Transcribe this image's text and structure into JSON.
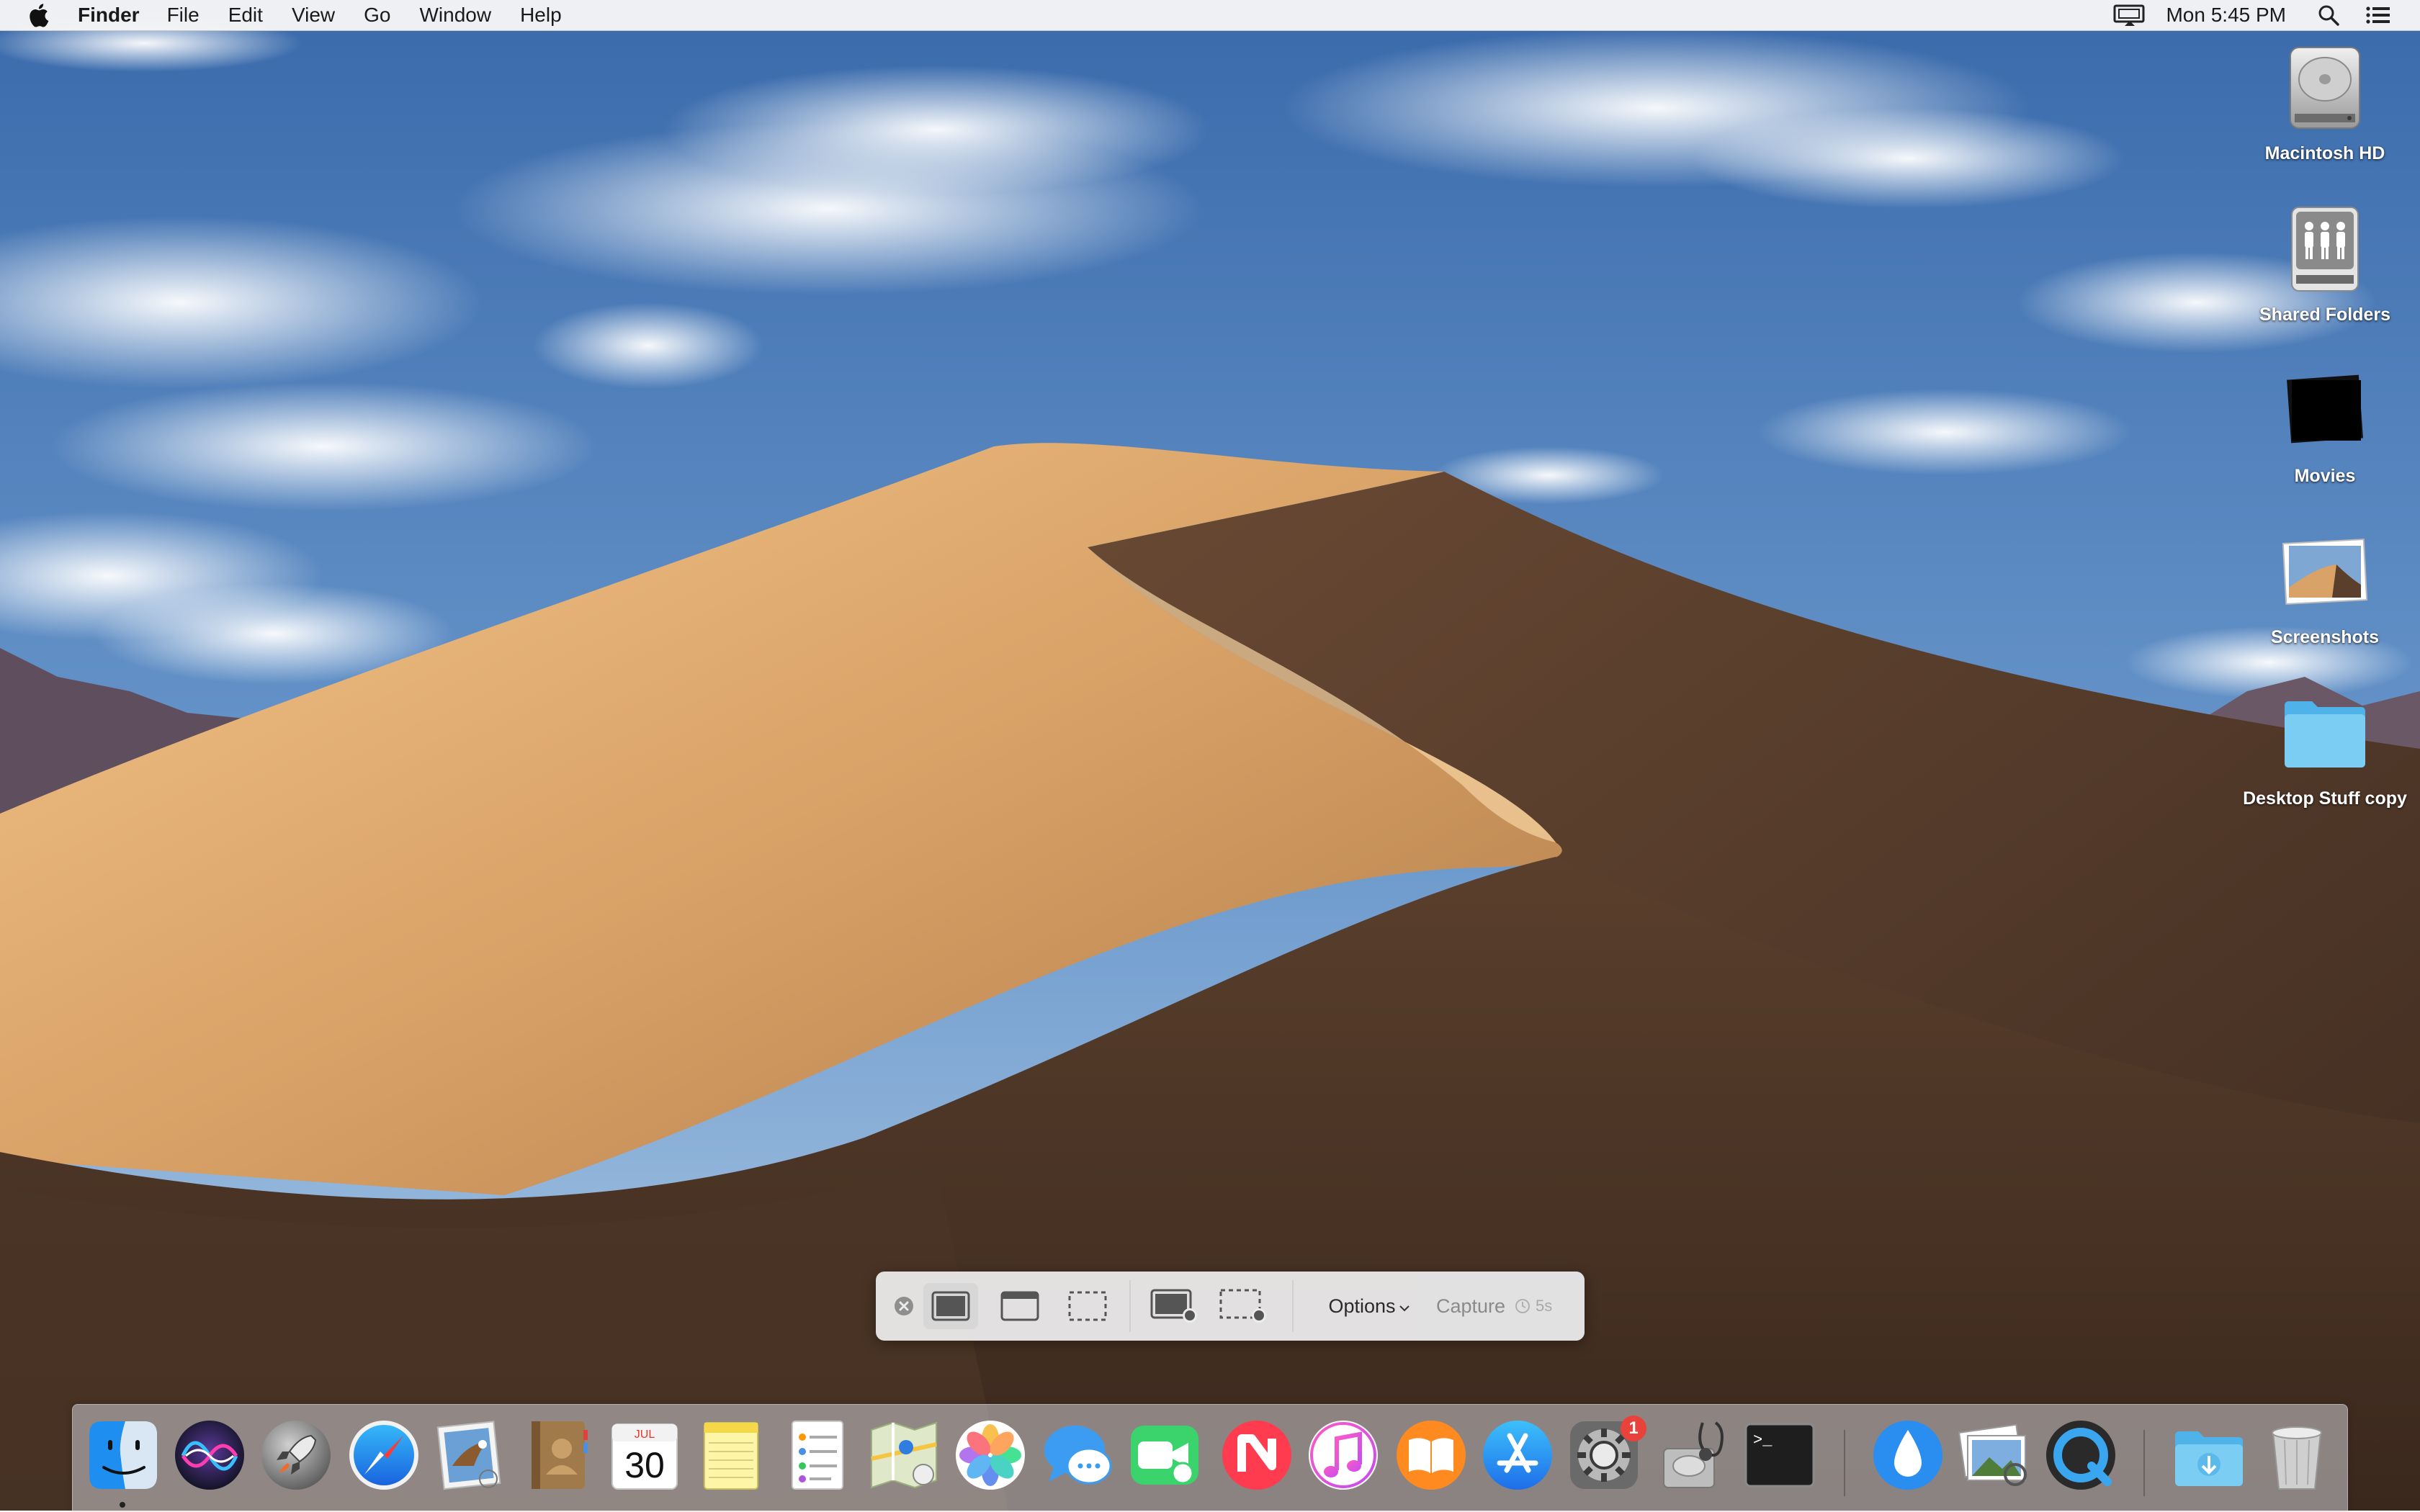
{
  "menubar": {
    "app_name": "Finder",
    "menus": [
      "File",
      "Edit",
      "View",
      "Go",
      "Window",
      "Help"
    ],
    "clock": "Mon 5:45 PM",
    "status_icons": [
      "airplay-display-icon",
      "spotlight-search-icon",
      "notification-center-icon"
    ]
  },
  "desktop": {
    "icons": [
      {
        "label": "Macintosh HD",
        "icon": "hard-drive-icon"
      },
      {
        "label": "Shared Folders",
        "icon": "shared-folders-drive-icon"
      },
      {
        "label": "Movies",
        "icon": "movies-folder-icon"
      },
      {
        "label": "Screenshots",
        "icon": "screenshots-image-icon"
      },
      {
        "label": "Desktop Stuff copy",
        "icon": "folder-icon"
      }
    ]
  },
  "screenshot_toolbar": {
    "tools": [
      "close-icon",
      "capture-entire-screen-icon",
      "capture-selected-window-icon",
      "capture-selected-portion-icon",
      "record-entire-screen-icon",
      "record-selected-portion-icon"
    ],
    "selected_tool": "capture-entire-screen-icon",
    "options_label": "Options",
    "capture_label": "Capture",
    "timer_label": "5s"
  },
  "dock": {
    "apps": [
      {
        "name": "Finder",
        "icon": "finder-icon",
        "running": true
      },
      {
        "name": "Siri",
        "icon": "siri-icon"
      },
      {
        "name": "Launchpad",
        "icon": "launchpad-rocket-icon"
      },
      {
        "name": "Safari",
        "icon": "safari-compass-icon"
      },
      {
        "name": "Mail",
        "icon": "mail-eagle-stamp-icon"
      },
      {
        "name": "Contacts",
        "icon": "contacts-book-icon"
      },
      {
        "name": "Calendar",
        "icon": "calendar-icon",
        "month": "JUL",
        "day": "30"
      },
      {
        "name": "Notes",
        "icon": "notes-icon"
      },
      {
        "name": "Reminders",
        "icon": "reminders-icon"
      },
      {
        "name": "Maps",
        "icon": "maps-icon"
      },
      {
        "name": "Photos",
        "icon": "photos-flower-icon"
      },
      {
        "name": "Messages",
        "icon": "messages-bubble-icon"
      },
      {
        "name": "FaceTime",
        "icon": "facetime-camera-icon"
      },
      {
        "name": "News",
        "icon": "news-icon"
      },
      {
        "name": "iTunes",
        "icon": "itunes-music-note-icon"
      },
      {
        "name": "Books",
        "icon": "books-icon"
      },
      {
        "name": "App Store",
        "icon": "app-store-icon"
      },
      {
        "name": "System Preferences",
        "icon": "system-preferences-gear-icon",
        "badge": "1"
      },
      {
        "name": "Disk Utility",
        "icon": "disk-utility-stethoscope-icon"
      },
      {
        "name": "Terminal",
        "icon": "terminal-icon",
        "prompt": ">_"
      },
      {
        "name": "Drop",
        "icon": "water-drop-icon"
      },
      {
        "name": "Preview",
        "icon": "preview-photos-icon"
      },
      {
        "name": "QuickTime Player",
        "icon": "quicktime-icon"
      },
      {
        "name": "Downloads",
        "icon": "downloads-folder-icon"
      },
      {
        "name": "Trash",
        "icon": "trash-can-icon"
      }
    ]
  },
  "colors": {
    "sky_top": "#3d6fb0",
    "sky_bottom": "#a9c6e4",
    "dune_light": "#e8b57a",
    "dune_shadow": "#4a3426",
    "folder_blue": "#6cc3f0",
    "badge_red": "#e8423a"
  }
}
